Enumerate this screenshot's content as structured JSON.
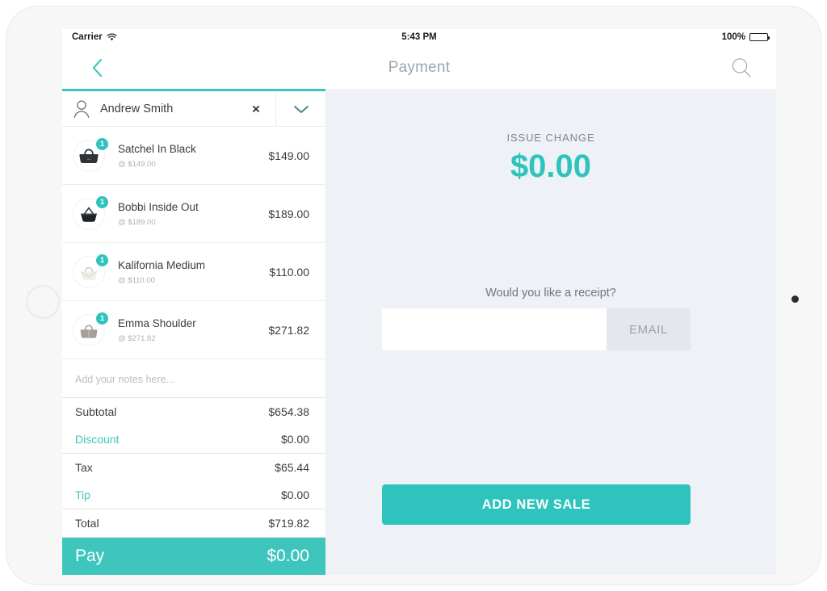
{
  "status_bar": {
    "carrier": "Carrier",
    "wifi_icon": "wifi-icon",
    "time": "5:43 PM",
    "battery_percent": "100%",
    "battery_icon": "battery-full-icon"
  },
  "nav_bar": {
    "back_icon": "chevron-left-icon",
    "title": "Payment",
    "search_icon": "search-icon"
  },
  "cart": {
    "customer": {
      "person_icon": "person-icon",
      "name": "Andrew Smith",
      "clear_label": "×",
      "expand_icon": "chevron-down-icon"
    },
    "items": [
      {
        "name": "Satchel In Black",
        "unit": "@ $149.00",
        "price": "$149.00",
        "qty": "1",
        "thumb": "handbag-black-satchel-icon"
      },
      {
        "name": "Bobbi Inside Out",
        "unit": "@ $189.00",
        "price": "$189.00",
        "qty": "1",
        "thumb": "tote-black-icon"
      },
      {
        "name": "Kalifornia Medium",
        "unit": "@ $110.00",
        "price": "$110.00",
        "qty": "1",
        "thumb": "handbag-white-icon"
      },
      {
        "name": "Emma Shoulder",
        "unit": "@ $271.82",
        "price": "$271.82",
        "qty": "1",
        "thumb": "handbag-taupe-icon"
      }
    ],
    "notes_placeholder": "Add your notes here...",
    "totals": [
      {
        "label": "Subtotal",
        "value": "$654.38",
        "link": false
      },
      {
        "label": "Discount",
        "value": "$0.00",
        "link": true
      },
      {
        "label": "Tax",
        "value": "$65.44",
        "link": false
      },
      {
        "label": "Tip",
        "value": "$0.00",
        "link": true
      },
      {
        "label": "Total",
        "value": "$719.82",
        "link": false
      }
    ],
    "pay": {
      "label": "Pay",
      "amount": "$0.00"
    }
  },
  "payment_panel": {
    "issue_change_label": "ISSUE CHANGE",
    "issue_change_amount": "$0.00",
    "receipt_question": "Would you like a receipt?",
    "email_value": "",
    "email_placeholder": "",
    "email_button": "EMAIL",
    "add_new_sale": "ADD NEW SALE"
  },
  "colors": {
    "accent_teal": "#2ec4bd",
    "panel_bg": "#eef1f5",
    "nav_title": "#9aa7b0",
    "muted_text": "#b2b2b2"
  }
}
